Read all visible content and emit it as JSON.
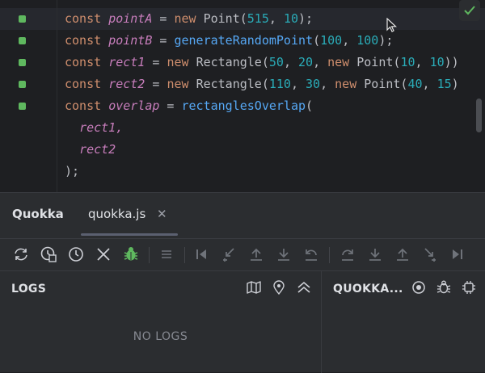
{
  "editor": {
    "lines": [
      {
        "t1": "const ",
        "t2": "pointA",
        "t3": " = ",
        "t4": "new ",
        "t5": "Point(",
        "t6": "515",
        "t7": ", ",
        "t8": "10",
        "t9": ");",
        "t10": "",
        "t11": "",
        "t12": "",
        "t13": "",
        "t14": "",
        "t15": "",
        "t16": ""
      },
      {
        "t1": "const ",
        "t2": "pointB",
        "t3": " = ",
        "t4": "",
        "t5": "generateRandomPoint",
        "t6": "(",
        "t7": "100",
        "t8": ", ",
        "t9": "100",
        "t10": ");",
        "t11": "",
        "t12": "",
        "t13": "",
        "t14": "",
        "t15": "",
        "t16": ""
      },
      {
        "t1": "const ",
        "t2": "rect1",
        "t3": " = ",
        "t4": "new ",
        "t5": "Rectangle(",
        "t6": "50",
        "t7": ", ",
        "t8": "20",
        "t9": ", ",
        "t10": "new ",
        "t11": "Point(",
        "t12": "10",
        "t13": ", ",
        "t14": "10",
        "t15": "))",
        "t16": ""
      },
      {
        "t1": "const ",
        "t2": "rect2",
        "t3": " = ",
        "t4": "new ",
        "t5": "Rectangle(",
        "t6": "110",
        "t7": ", ",
        "t8": "30",
        "t9": ", ",
        "t10": "new ",
        "t11": "Point(",
        "t12": "40",
        "t13": ", ",
        "t14": "15",
        "t15": ")",
        "t16": ""
      },
      {
        "t1": "const ",
        "t2": "overlap",
        "t3": " = ",
        "t4": "",
        "t5": "rectanglesOverlap",
        "t6": "(",
        "t7": "",
        "t8": "",
        "t9": "",
        "t10": "",
        "t11": "",
        "t12": "",
        "t13": "",
        "t14": "",
        "t15": "",
        "t16": ""
      }
    ],
    "arg1": "rect1,",
    "arg2": "rect2",
    "close": ");",
    "indent": "  "
  },
  "tool_window": {
    "title": "Quokka",
    "file_tab": "quokka.js",
    "close_glyph": "✕"
  },
  "logs": {
    "title": "LOGS",
    "empty": "NO LOGS"
  },
  "quokka_panel": {
    "title": "QUOKKA..."
  },
  "colors": {
    "marker": "#5fb85f",
    "keyword": "#cf8e6d",
    "variable": "#c77dbb",
    "function": "#56a8f5",
    "number": "#2aacb8",
    "debug_green": "#5fb85f"
  }
}
